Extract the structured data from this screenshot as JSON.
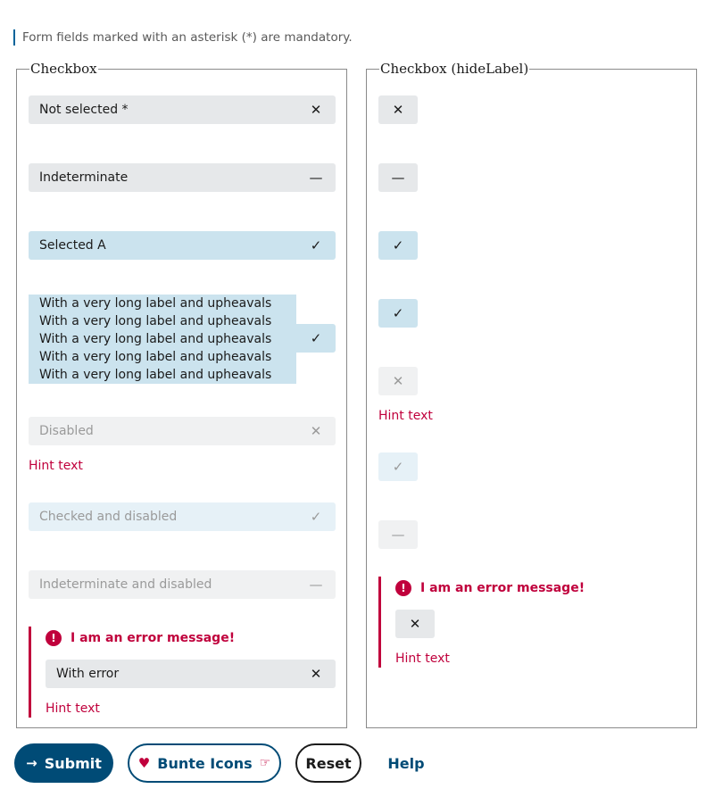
{
  "notice": "Form fields marked with an asterisk (*) are mandatory.",
  "left": {
    "legend": "Checkbox",
    "not_selected": "Not selected",
    "required_mark": "*",
    "indeterminate": "Indeterminate",
    "selected_a": "Selected A",
    "long_label": "With a very long label and upheavals With a very long label and upheavals With a very long label and upheavals With a very long label and upheavals With a very long label and upheavals",
    "disabled": "Disabled",
    "hint1": "Hint text",
    "checked_disabled": "Checked and disabled",
    "indeterminate_disabled": "Indeterminate and disabled",
    "error_message": "I am an error message!",
    "with_error": "With error",
    "hint2": "Hint text"
  },
  "right": {
    "legend": "Checkbox (hideLabel)",
    "hint1": "Hint text",
    "error_message": "I am an error message!",
    "hint2": "Hint text"
  },
  "icons": {
    "x": "✕",
    "dash": "—",
    "check": "✓",
    "error": "!",
    "arrow": "→",
    "heart": "♥",
    "hand": "☞"
  },
  "buttons": {
    "submit": "Submit",
    "bunte": "Bunte Icons",
    "reset": "Reset",
    "help": "Help"
  },
  "colors": {
    "primary": "#004b76",
    "error": "#c0003c",
    "selected_bg": "#cbe3ee"
  }
}
